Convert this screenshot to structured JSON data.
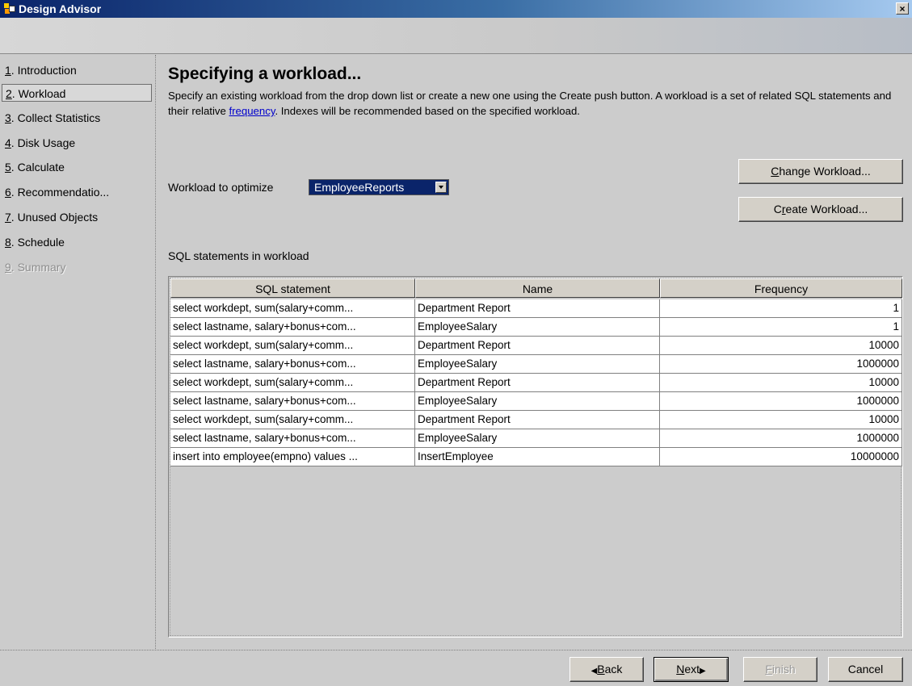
{
  "window": {
    "title": "Design Advisor",
    "close_glyph": "×",
    "icon": "design-advisor-app-icon"
  },
  "nav": {
    "items": [
      {
        "num": "1",
        "rest": ". Introduction",
        "state": "normal"
      },
      {
        "num": "2",
        "rest": ". Workload",
        "state": "selected"
      },
      {
        "num": "3",
        "rest": ". Collect Statistics",
        "state": "normal"
      },
      {
        "num": "4",
        "rest": ". Disk Usage",
        "state": "normal"
      },
      {
        "num": "5",
        "rest": ". Calculate",
        "state": "normal"
      },
      {
        "num": "6",
        "rest": ". Recommendatio...",
        "state": "normal"
      },
      {
        "num": "7",
        "rest": ". Unused Objects",
        "state": "normal"
      },
      {
        "num": "8",
        "rest": ". Schedule",
        "state": "normal"
      },
      {
        "num": "9",
        "rest": ". Summary",
        "state": "disabled"
      }
    ]
  },
  "main": {
    "title": "Specifying a workload...",
    "description": {
      "before": "Specify an existing workload from the drop down list or create a new one using the Create push button. A workload is a set of related SQL statements and their relative ",
      "link": "frequency",
      "after": ". Indexes will be recommended based on the specified workload."
    },
    "workload_label": "Workload to optimize",
    "workload_value": "EmployeeReports",
    "buttons": {
      "change_mn": "C",
      "change_rest": "hange Workload...",
      "create_pre": "C",
      "create_mn": "r",
      "create_rest": "eate Workload..."
    },
    "sql_label": "SQL statements in workload",
    "table": {
      "headers": [
        "SQL statement",
        "Name",
        "Frequency"
      ],
      "rows": [
        [
          "select workdept, sum(salary+comm...",
          "Department Report",
          "1"
        ],
        [
          "select lastname, salary+bonus+com...",
          "EmployeeSalary",
          "1"
        ],
        [
          "select workdept, sum(salary+comm...",
          "Department Report",
          "10000"
        ],
        [
          "select lastname, salary+bonus+com...",
          "EmployeeSalary",
          "1000000"
        ],
        [
          "select workdept, sum(salary+comm...",
          "Department Report",
          "10000"
        ],
        [
          "select lastname, salary+bonus+com...",
          "EmployeeSalary",
          "1000000"
        ],
        [
          "select workdept, sum(salary+comm...",
          "Department Report",
          "10000"
        ],
        [
          "select lastname, salary+bonus+com...",
          "EmployeeSalary",
          "1000000"
        ],
        [
          "insert into employee(empno) values ...",
          "InsertEmployee",
          "10000000"
        ]
      ]
    }
  },
  "footer": {
    "back_arrow": "◀",
    "back_mn": "B",
    "back_rest": "ack",
    "next_mn": "N",
    "next_rest": "ext",
    "next_arrow": "▶",
    "finish_mn": "F",
    "finish_rest": "inish",
    "cancel": "Cancel"
  },
  "colors": {
    "background": "#cccccc",
    "selection": "#0a246a",
    "link": "#0000cc"
  }
}
